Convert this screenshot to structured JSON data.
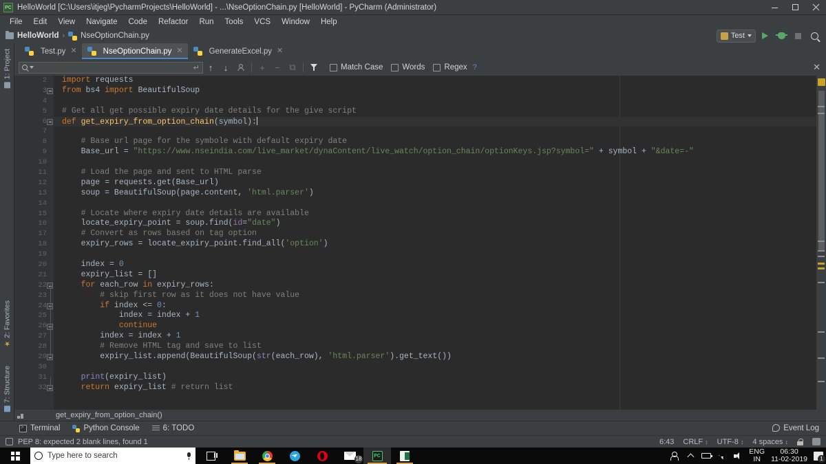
{
  "window": {
    "title": "HelloWorld [C:\\Users\\itjeg\\PycharmProjects\\HelloWorld] - ...\\NseOptionChain.py [HelloWorld] - PyCharm (Administrator)",
    "app_icon": "pycharm-icon",
    "controls": {
      "minimize": "—",
      "maximize": "❐",
      "close": "✕"
    }
  },
  "menu": {
    "items": [
      "File",
      "Edit",
      "View",
      "Navigate",
      "Code",
      "Refactor",
      "Run",
      "Tools",
      "VCS",
      "Window",
      "Help"
    ]
  },
  "breadcrumb": {
    "project": "HelloWorld",
    "separator": "›",
    "file": "NseOptionChain.py"
  },
  "toolbar": {
    "run_config": "Test",
    "run_label": "Run",
    "debug_label": "Debug",
    "stop_label": "Stop",
    "search_label": "Search Everywhere"
  },
  "editor_tabs": [
    {
      "label": "Test.py",
      "active": false,
      "close": "✕"
    },
    {
      "label": "NseOptionChain.py",
      "active": true,
      "close": "✕"
    },
    {
      "label": "GenerateExcel.py",
      "active": false,
      "close": "✕"
    }
  ],
  "left_tool_strip": [
    {
      "label": "1: Project",
      "icon": "project-icon"
    },
    {
      "label": "2: Favorites",
      "icon": "star-icon"
    },
    {
      "label": "7: Structure",
      "icon": "structure-icon"
    }
  ],
  "find_toolbar": {
    "query_value": "",
    "query_placeholder": "",
    "prev_label": "↑",
    "next_label": "↓",
    "select_all_label": "Ⓐ",
    "add_line_label": "+",
    "remove_line_label": "−",
    "copy_label": "⧉",
    "filter_label": "Filter",
    "checkboxes": [
      {
        "label": "Match Case",
        "checked": false
      },
      {
        "label": "Words",
        "checked": false
      },
      {
        "label": "Regex",
        "checked": false
      }
    ],
    "help": "?",
    "close": "✕"
  },
  "code": {
    "first_line_number": 2,
    "highlighted_line": 6,
    "caret_line": 6,
    "lines": [
      {
        "n": 2,
        "tokens": [
          {
            "t": "import",
            "c": "k"
          },
          {
            "t": " requests",
            "c": "d"
          }
        ]
      },
      {
        "n": 3,
        "fold": "end",
        "tokens": [
          {
            "t": "from",
            "c": "k"
          },
          {
            "t": " bs4 ",
            "c": "d"
          },
          {
            "t": "import",
            "c": "k"
          },
          {
            "t": " BeautifulSoup",
            "c": "d"
          }
        ]
      },
      {
        "n": 4,
        "tokens": []
      },
      {
        "n": 5,
        "tokens": [
          {
            "t": "# Get all get possible expiry date details for the give script",
            "c": "c"
          }
        ]
      },
      {
        "n": 6,
        "fold": "open",
        "hl": true,
        "caret": true,
        "tokens": [
          {
            "t": "def ",
            "c": "k"
          },
          {
            "t": "get_expiry_from_option_chain",
            "c": "f"
          },
          {
            "t": "(symbol):",
            "c": "d"
          }
        ]
      },
      {
        "n": 7,
        "tokens": []
      },
      {
        "n": 8,
        "tokens": [
          {
            "t": "    # Base url page for the symbole with default expiry date",
            "c": "c"
          }
        ]
      },
      {
        "n": 9,
        "tokens": [
          {
            "t": "    Base_url = ",
            "c": "d"
          },
          {
            "t": "\"https://www.nseindia.com/live_market/dynaContent/live_watch/option_chain/optionKeys.jsp?symbol=\"",
            "c": "s"
          },
          {
            "t": " + symbol + ",
            "c": "d"
          },
          {
            "t": "\"&date=-\"",
            "c": "s"
          }
        ]
      },
      {
        "n": 10,
        "tokens": []
      },
      {
        "n": 11,
        "tokens": [
          {
            "t": "    # Load the page and sent to HTML parse",
            "c": "c"
          }
        ]
      },
      {
        "n": 12,
        "tokens": [
          {
            "t": "    page = requests.get(Base_url)",
            "c": "d"
          }
        ]
      },
      {
        "n": 13,
        "tokens": [
          {
            "t": "    soup = BeautifulSoup(page.content, ",
            "c": "d"
          },
          {
            "t": "'html.parser'",
            "c": "s"
          },
          {
            "t": ")",
            "c": "d"
          }
        ]
      },
      {
        "n": 14,
        "tokens": []
      },
      {
        "n": 15,
        "tokens": [
          {
            "t": "    # Locate where expiry date details are available",
            "c": "c"
          }
        ]
      },
      {
        "n": 16,
        "tokens": [
          {
            "t": "    locate_expiry_point = soup.find(",
            "c": "d"
          },
          {
            "t": "id",
            "c": "kw"
          },
          {
            "t": "=",
            "c": "d"
          },
          {
            "t": "\"date\"",
            "c": "s"
          },
          {
            "t": ")",
            "c": "d"
          }
        ]
      },
      {
        "n": 17,
        "tokens": [
          {
            "t": "    # Convert as rows based on tag option",
            "c": "c"
          }
        ]
      },
      {
        "n": 18,
        "tokens": [
          {
            "t": "    expiry_rows = locate_expiry_point.find_all(",
            "c": "d"
          },
          {
            "t": "'option'",
            "c": "s"
          },
          {
            "t": ")",
            "c": "d"
          }
        ]
      },
      {
        "n": 19,
        "tokens": []
      },
      {
        "n": 20,
        "tokens": [
          {
            "t": "    index = ",
            "c": "d"
          },
          {
            "t": "0",
            "c": "n"
          }
        ]
      },
      {
        "n": 21,
        "tokens": [
          {
            "t": "    expiry_list = []",
            "c": "d"
          }
        ]
      },
      {
        "n": 22,
        "fold": "open",
        "tokens": [
          {
            "t": "    for",
            "c": "k"
          },
          {
            "t": " each_row ",
            "c": "d"
          },
          {
            "t": "in",
            "c": "k"
          },
          {
            "t": " expiry_rows:",
            "c": "d"
          }
        ]
      },
      {
        "n": 23,
        "tokens": [
          {
            "t": "        # skip first row as it does not have value",
            "c": "c"
          }
        ]
      },
      {
        "n": 24,
        "fold": "open",
        "tokens": [
          {
            "t": "        if",
            "c": "k"
          },
          {
            "t": " index <= ",
            "c": "d"
          },
          {
            "t": "0",
            "c": "n"
          },
          {
            "t": ":",
            "c": "d"
          }
        ]
      },
      {
        "n": 25,
        "tokens": [
          {
            "t": "            index = index + ",
            "c": "d"
          },
          {
            "t": "1",
            "c": "n"
          }
        ]
      },
      {
        "n": 26,
        "fold": "end",
        "tokens": [
          {
            "t": "            continue",
            "c": "k"
          }
        ]
      },
      {
        "n": 27,
        "tokens": [
          {
            "t": "        index = index + ",
            "c": "d"
          },
          {
            "t": "1",
            "c": "n"
          }
        ]
      },
      {
        "n": 28,
        "tokens": [
          {
            "t": "        # Remove HTML tag and save to list",
            "c": "c"
          }
        ]
      },
      {
        "n": 29,
        "fold": "end",
        "tokens": [
          {
            "t": "        expiry_list.append(BeautifulSoup(",
            "c": "d"
          },
          {
            "t": "str",
            "c": "b"
          },
          {
            "t": "(each_row), ",
            "c": "d"
          },
          {
            "t": "'html.parser'",
            "c": "s"
          },
          {
            "t": ").get_text())",
            "c": "d"
          }
        ]
      },
      {
        "n": 30,
        "tokens": []
      },
      {
        "n": 31,
        "tokens": [
          {
            "t": "    ",
            "c": "d"
          },
          {
            "t": "print",
            "c": "b"
          },
          {
            "t": "(expiry_list)",
            "c": "d"
          }
        ]
      },
      {
        "n": 32,
        "fold": "end",
        "tokens": [
          {
            "t": "    return",
            "c": "k"
          },
          {
            "t": " expiry_list ",
            "c": "d"
          },
          {
            "t": "# return list",
            "c": "c"
          }
        ]
      }
    ]
  },
  "editor_breadcrumb": {
    "text": "get_expiry_from_option_chain()"
  },
  "tool_windows": [
    {
      "label": "Terminal",
      "icon": "terminal-icon"
    },
    {
      "label": "Python Console",
      "icon": "python-console-icon"
    },
    {
      "label": "6: TODO",
      "icon": "todo-icon"
    }
  ],
  "event_log": {
    "label": "Event Log",
    "icon": "event-log-icon"
  },
  "status_bar": {
    "message": "PEP 8: expected 2 blank lines, found 1",
    "caret_position": "6:43",
    "line_separator": "CRLF",
    "encoding": "UTF-8",
    "indent": "4 spaces",
    "lock_label": "lock-icon",
    "hydra_label": "hector-icon",
    "separator": "↕"
  },
  "taskbar": {
    "search_placeholder": "Type here to search",
    "apps": [
      {
        "name": "task-view",
        "state": "none"
      },
      {
        "name": "file-explorer",
        "state": "open"
      },
      {
        "name": "chrome",
        "state": "open"
      },
      {
        "name": "telegram",
        "state": "none"
      },
      {
        "name": "opera",
        "state": "none"
      },
      {
        "name": "mail",
        "state": "none",
        "badge": "18"
      },
      {
        "name": "pycharm",
        "state": "active"
      },
      {
        "name": "excel",
        "state": "open"
      }
    ],
    "tray": {
      "language_line1": "ENG",
      "language_line2": "IN",
      "time": "06:30",
      "date": "11-02-2019",
      "notification_count": "1"
    }
  },
  "colors": {
    "accent_tab": "#4a88c7",
    "run_green": "#59a869",
    "warning_yellow": "#c9a227",
    "keyword": "#cc7832",
    "string": "#6a8759",
    "comment": "#808080",
    "number": "#6897bb",
    "function": "#ffc66d",
    "editor_bg": "#2b2b2b",
    "chrome_bg": "#3c3f41"
  }
}
